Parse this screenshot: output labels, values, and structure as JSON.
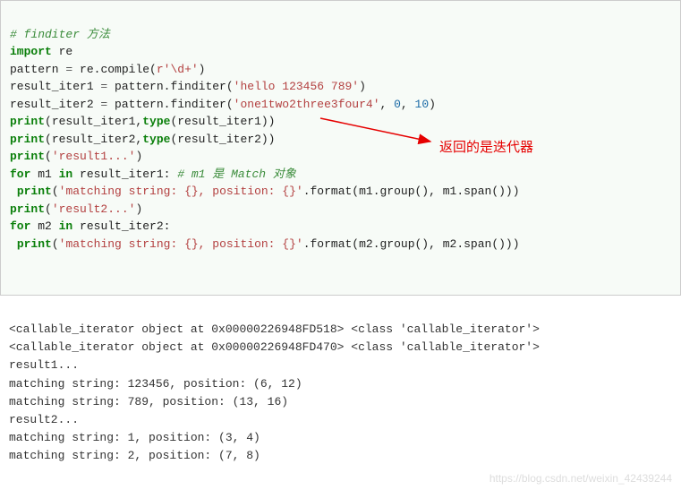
{
  "code": {
    "line1": "# finditer 方法",
    "line2_kw": "import",
    "line2_mod": " re",
    "line3_a": "pattern ",
    "line3_op": "=",
    "line3_b": " re.compile(",
    "line3_str": "r'\\d+'",
    "line3_c": ")",
    "line4_a": "result_iter1 ",
    "line4_op": "=",
    "line4_b": " pattern.finditer(",
    "line4_str": "'hello 123456 789'",
    "line4_c": ")",
    "line5_a": "result_iter2 ",
    "line5_op": "=",
    "line5_b": " pattern.finditer(",
    "line5_str": "'one1two2three3four4'",
    "line5_c": ", ",
    "line5_n1": "0",
    "line5_d": ", ",
    "line5_n2": "10",
    "line5_e": ")",
    "line6_p": "print",
    "line6_a": "(result_iter1,",
    "line6_t": "type",
    "line6_b": "(result_iter1))",
    "line7_p": "print",
    "line7_a": "(result_iter2,",
    "line7_t": "type",
    "line7_b": "(result_iter2))",
    "line8_p": "print",
    "line8_a": "(",
    "line8_str": "'result1...'",
    "line8_b": ")",
    "line9_for": "for",
    "line9_a": " m1 ",
    "line9_in": "in",
    "line9_b": " result_iter1: ",
    "line9_c": "# m1 是 Match 对象",
    "line10_sp": " ",
    "line10_p": "print",
    "line10_a": "(",
    "line10_str": "'matching string: {}, position: {}'",
    "line10_b": ".format(m1.group(), m1.span()))",
    "line11_p": "print",
    "line11_a": "(",
    "line11_str": "'result2...'",
    "line11_b": ")",
    "line12_for": "for",
    "line12_a": " m2 ",
    "line12_in": "in",
    "line12_b": " result_iter2:",
    "line13_sp": " ",
    "line13_p": "print",
    "line13_a": "(",
    "line13_str": "'matching string: {}, position: {}'",
    "line13_b": ".format(m2.group(), m2.span()))"
  },
  "annotation": "返回的是迭代器",
  "output": {
    "l1": "<callable_iterator object at 0x00000226948FD518> <class 'callable_iterator'>",
    "l2": "<callable_iterator object at 0x00000226948FD470> <class 'callable_iterator'>",
    "l3": "result1...",
    "l4": "matching string: 123456, position: (6, 12)",
    "l5": "matching string: 789, position: (13, 16)",
    "l6": "result2...",
    "l7": "matching string: 1, position: (3, 4)",
    "l8": "matching string: 2, position: (7, 8)"
  },
  "watermark": "https://blog.csdn.net/weixin_42439244"
}
